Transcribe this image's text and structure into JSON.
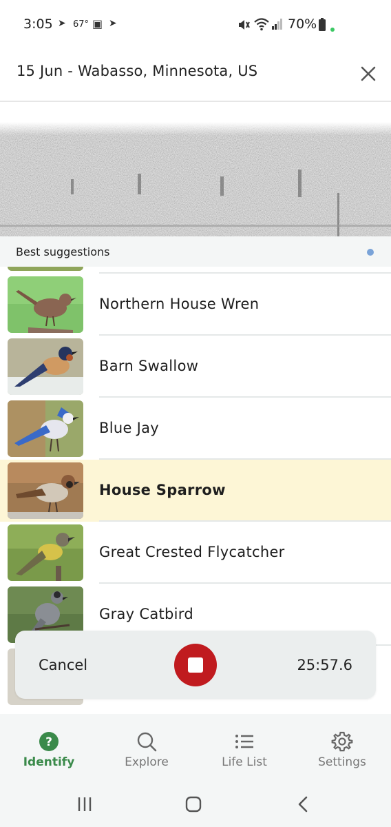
{
  "status_bar": {
    "time": "3:05",
    "temperature": "67°",
    "battery": "70%"
  },
  "header": {
    "title": "15 Jun - Wabasso, Minnesota, US",
    "close_icon": "close-icon"
  },
  "suggestions": {
    "label": "Best suggestions",
    "items": [
      {
        "name": "Northern House Wren",
        "highlighted": false
      },
      {
        "name": "Barn Swallow",
        "highlighted": false
      },
      {
        "name": "Blue Jay",
        "highlighted": false
      },
      {
        "name": "House Sparrow",
        "highlighted": true
      },
      {
        "name": "Great Crested Flycatcher",
        "highlighted": false
      },
      {
        "name": "Gray Catbird",
        "highlighted": false
      }
    ]
  },
  "recording": {
    "cancel_label": "Cancel",
    "timer": "25:57.6",
    "stop_icon": "stop-icon"
  },
  "bottom_nav": {
    "items": [
      {
        "label": "Identify",
        "icon": "question-circle-icon",
        "active": true
      },
      {
        "label": "Explore",
        "icon": "search-icon",
        "active": false
      },
      {
        "label": "Life List",
        "icon": "list-icon",
        "active": false
      },
      {
        "label": "Settings",
        "icon": "gear-icon",
        "active": false
      }
    ]
  },
  "colors": {
    "accent": "#3a8a4a",
    "stop_button": "#c01b1f",
    "highlight_row": "#fdf6d6",
    "suggest_dot": "#7aa3d8"
  }
}
